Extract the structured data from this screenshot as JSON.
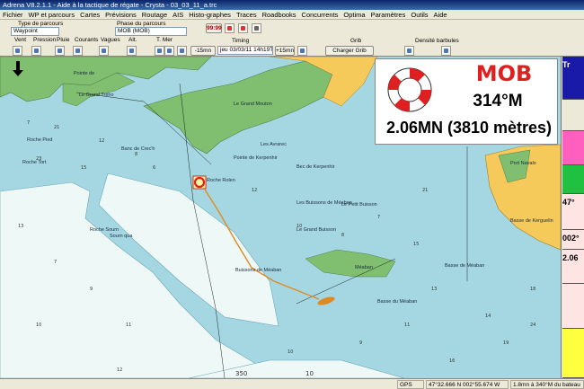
{
  "window": {
    "title": "Adrena V8.2.1.1 - Aide à la tactique de régate - Crysta - 03_03_11_a.trc"
  },
  "menu": [
    "Fichier",
    "WP et parcours",
    "Cartes",
    "Prévisions",
    "Routage",
    "AIS",
    "Histo-graphes",
    "Traces",
    "Roadbooks",
    "Concurrents",
    "Optima",
    "Paramètres",
    "Outils",
    "Aide"
  ],
  "toolbar": {
    "type_parcours_label": "Type de parcours",
    "phase_parcours_label": "Phase du parcours",
    "type_parcours_value": "Waypoint",
    "phase_parcours_value": "MOB (MOB)",
    "layer_labels": [
      "Vent",
      "Pression",
      "Pluie",
      "Courants",
      "Vagues",
      "Alt.",
      "T. Mer"
    ],
    "timing_label": "Timing",
    "back_label": "-15mn",
    "time_value": "jeu 03/03/11 14h19TU",
    "forward_label": "+15mn",
    "grib_label": "Grib",
    "charger_grib_label": "Charger Grib",
    "densite_label": "Densité barbules",
    "clock_label": "99:99"
  },
  "mob_panel": {
    "title": "MOB",
    "bearing": "314°M",
    "distance": "2.06MN (3810 mètres)"
  },
  "right_panel": {
    "items": [
      {
        "text": "Tr",
        "color": "#2a2aa0",
        "bg": "#1a1aa8"
      },
      {
        "text": "",
        "color": "#000",
        "bg": "#ece9d8"
      },
      {
        "text": "",
        "color": "#000",
        "bg": "#ff60c0"
      },
      {
        "text": "",
        "color": "#000",
        "bg": "#20c040"
      },
      {
        "text": "47°",
        "color": "#000",
        "bg": "#ffe4e4"
      },
      {
        "text": "002°",
        "color": "#000",
        "bg": "#ffe4e4"
      },
      {
        "text": "2.06",
        "color": "#000",
        "bg": "#ffe4e4"
      },
      {
        "text": "",
        "color": "#000",
        "bg": "#ffe4e4"
      },
      {
        "text": "",
        "color": "#000",
        "bg": "#ffff40"
      }
    ]
  },
  "map": {
    "place_names": [
      "Pointe de",
      "Le Grand Trého",
      "Roche Pied",
      "Banc de Crec'h",
      "Roche Tort",
      "Roche Sourn",
      "Sourn qua",
      "Le Grand Mouton",
      "Pointe de Kerpenhir",
      "Port Navalo",
      "Basse de Kerguelin",
      "Bec de Kerpenhir",
      "Le Petit Buisson",
      "Le Grand Buisson",
      "Les Buissons de Méaban",
      "Basse de Méaban",
      "Basse du Méaban",
      "Méaban",
      "Buissons de Méaban",
      "Roche Rolen",
      "Les Avrarec"
    ],
    "scale_labels": [
      "350",
      "10"
    ]
  },
  "status": {
    "gps": "GPS",
    "position": "47°32.666 N  002°55.674 W",
    "boat": "1.8mn à 340°M du bateau"
  },
  "colors": {
    "sea": "#a5d7e3",
    "land": "#f5c95a",
    "green": "#7fbf6f",
    "shallow": "#eef8f6",
    "mob_red": "#e02020"
  }
}
